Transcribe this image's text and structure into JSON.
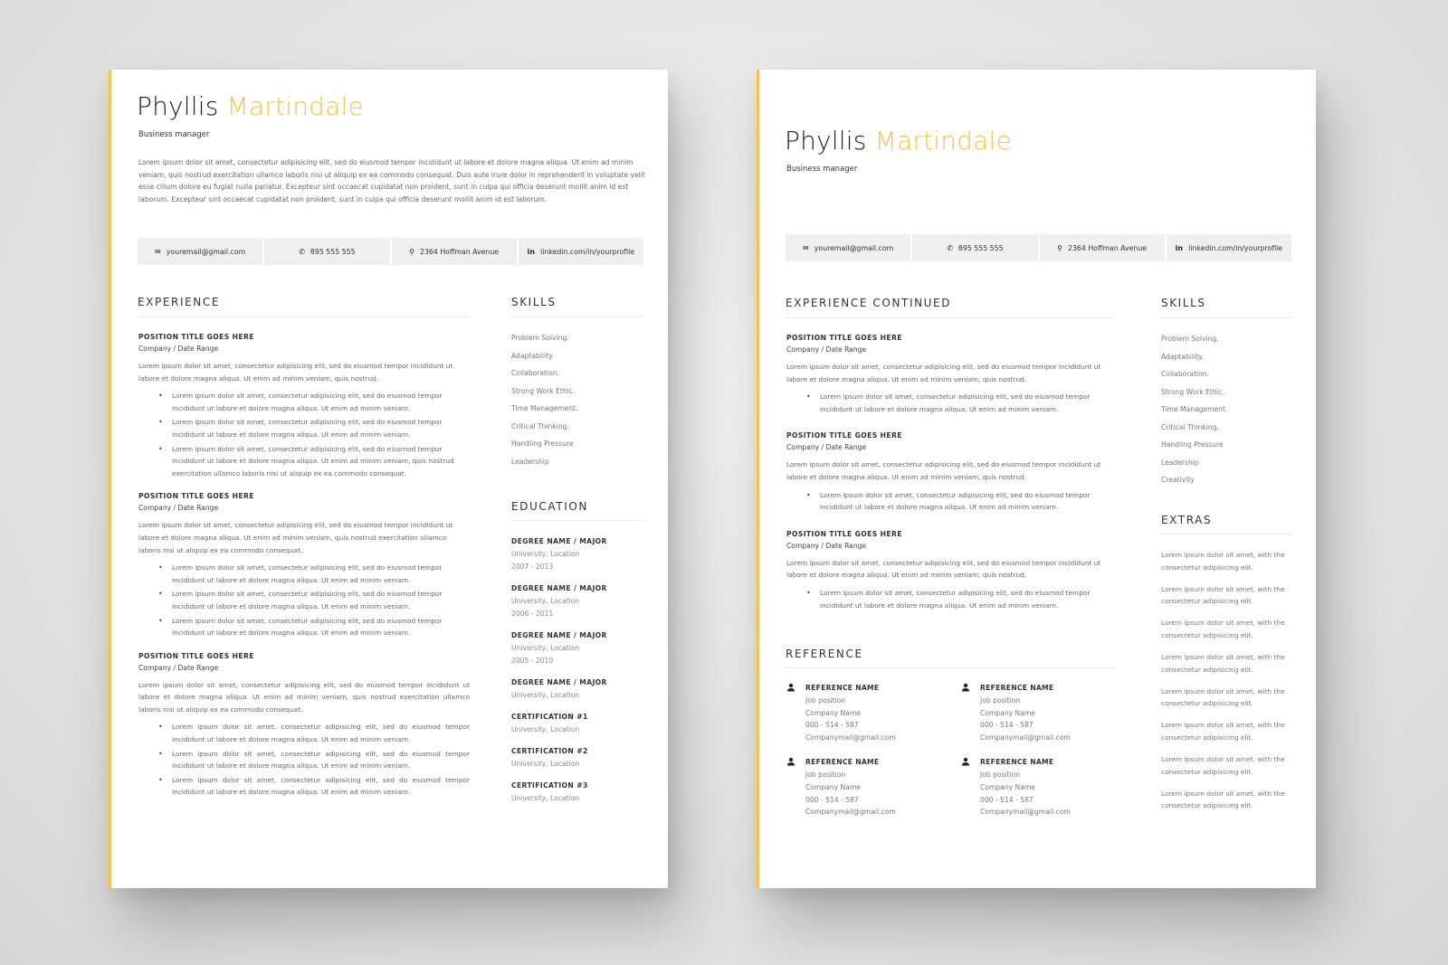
{
  "brand": {
    "accent_color": "#fbc14a",
    "text_color": "#222222",
    "bar_color": "#efefef"
  },
  "person": {
    "first_name": "Phyllis",
    "last_name": "Martindale",
    "title": "Business manager"
  },
  "summary": "Lorem ipsum dolor sit amet, consectetur adipisicing elit, sed do eiusmod tempor incididunt ut labore et dolore magna aliqua. Ut enim ad minim veniam, quis nostrud exercitation ullamco laboris nisi ut aliquip ex ea commodo consequat. Duis aute irure dolor in reprehenderit in voluptate velit esse cillum dolore eu fugiat nulla pariatur. Excepteur sint occaecat cupidatat non proident, sunt in culpa qui officia deserunt mollit anim id est laborum. Excepteur sint occaecat cupidatat non proident, sunt in culpa qui officia deserunt mollit anim id est laborum.",
  "contact": [
    {
      "icon": "envelope-icon",
      "glyph": "✉",
      "text": "youremail@gmail.com"
    },
    {
      "icon": "phone-icon",
      "glyph": "✆",
      "text": "895 555 555"
    },
    {
      "icon": "location-pin-icon",
      "glyph": "⚲",
      "text": "2364 Hoffman Avenue"
    },
    {
      "icon": "linkedin-icon",
      "glyph": "in",
      "text": "linkedin.com/in/yourprofile"
    }
  ],
  "page1": {
    "experience_title": "EXPERIENCE",
    "jobs": [
      {
        "title": "POSITION TITLE GOES HERE",
        "sub": "Company / Date Range",
        "desc": "Lorem ipsum dolor sit amet, consectetur adipisicing elit, sed do eiusmod tempor incididunt ut labore et dolore magna aliqua. Ut enim ad minim veniam, quis nostrud.",
        "bullets": [
          "Lorem ipsum dolor sit amet, consectetur adipisicing elit, sed do eiusmod tempor incididunt ut labore et dolore magna aliqua. Ut enim ad minim veniam.",
          "Lorem ipsum dolor sit amet, consectetur adipisicing elit, sed do eiusmod tempor incididunt ut labore et dolore magna aliqua. Ut enim ad minim veniam.",
          "Lorem ipsum dolor sit amet, consectetur adipisicing elit, sed do eiusmod tempor incididunt ut labore et dolore magna aliqua. Ut enim ad minim veniam, quis nostrud exercitation ullamco laboris nisi ut aliquip ex ea commodo consequat."
        ]
      },
      {
        "title": "POSITION TITLE GOES HERE",
        "sub": "Company / Date Range",
        "desc": "Lorem ipsum dolor sit amet, consectetur adipisicing elit, sed do eiusmod tempor incididunt ut labore et dolore magna aliqua. Ut enim ad minim veniam, quis nostrud exercitation ullamco laboris nisi ut aliquip ex ea commodo consequat.",
        "bullets": [
          "Lorem ipsum dolor sit amet, consectetur adipisicing elit, sed do eiusmod tempor incididunt ut labore et dolore magna aliqua. Ut enim ad minim veniam.",
          "Lorem ipsum dolor sit amet, consectetur adipisicing elit, sed do eiusmod tempor incididunt ut labore et dolore magna aliqua. Ut enim ad minim veniam.",
          "Lorem ipsum dolor sit amet, consectetur adipisicing elit, sed do eiusmod tempor incididunt ut labore et dolore magna aliqua. Ut enim ad minim veniam."
        ]
      },
      {
        "title": "POSITION TITLE GOES HERE",
        "sub": "Company / Date Range",
        "desc": "Lorem ipsum dolor sit amet, consectetur adipisicing elit, sed do eiusmod tempor incididunt ut labore et dolore magna aliqua. Ut enim ad minim veniam, quis nostrud exercitation ullamco laboris nisi ut aliquip ex ea commodo consequat.",
        "bullets": [
          "Lorem ipsum dolor sit amet, consectetur adipisicing elit, sed do eiusmod tempor incididunt ut labore et dolore magna aliqua. Ut enim ad minim veniam.",
          "Lorem ipsum dolor sit amet, consectetur adipisicing elit, sed do eiusmod tempor incididunt ut labore et dolore magna aliqua. Ut enim ad minim veniam.",
          "Lorem ipsum dolor sit amet, consectetur adipisicing elit, sed do eiusmod tempor incididunt ut labore et dolore magna aliqua. Ut enim ad minim veniam."
        ]
      }
    ],
    "skills_title": "SKILLS",
    "skills": [
      "Problem Solving.",
      "Adaptability.",
      "Collaboration.",
      "Strong Work Ethic.",
      "Time Management.",
      "Critical Thinking.",
      "Handling Pressure",
      "Leadership"
    ],
    "education_title": "EDUCATION",
    "education": [
      {
        "title": "DEGREE NAME / MAJOR",
        "lines": [
          "University, Location",
          "2007 - 2013"
        ]
      },
      {
        "title": "DEGREE NAME / MAJOR",
        "lines": [
          "University, Location",
          "2006 - 2011"
        ]
      },
      {
        "title": "DEGREE NAME / MAJOR",
        "lines": [
          "University, Location",
          "2005 - 2010"
        ]
      },
      {
        "title": "DEGREE NAME / MAJOR",
        "lines": [
          "University, Location"
        ]
      },
      {
        "title": "CERTIFICATION #1",
        "lines": [
          "University, Location"
        ]
      },
      {
        "title": "CERTIFICATION #2",
        "lines": [
          "University, Location"
        ]
      },
      {
        "title": "CERTIFICATION #3",
        "lines": [
          "University, Location"
        ]
      }
    ]
  },
  "page2": {
    "experience_title": "EXPERIENCE CONTINUED",
    "jobs": [
      {
        "title": "POSITION TITLE GOES HERE",
        "sub": "Company / Date Range",
        "desc": "Lorem ipsum dolor sit amet, consectetur adipisicing elit, sed do eiusmod tempor incididunt ut labore et dolore magna aliqua. Ut enim ad minim veniam, quis nostrud.",
        "bullets": [
          "Lorem ipsum dolor sit amet, consectetur adipisicing elit, sed do eiusmod tempor incididunt ut labore et dolore magna aliqua. Ut enim ad minim veniam."
        ]
      },
      {
        "title": "POSITION TITLE GOES HERE",
        "sub": "Company / Date Range",
        "desc": "Lorem ipsum dolor sit amet, consectetur adipisicing elit, sed do eiusmod tempor incididunt ut labore et dolore magna aliqua. Ut enim ad minim veniam, quis nostrud.",
        "bullets": [
          "Lorem ipsum dolor sit amet, consectetur adipisicing elit, sed do eiusmod tempor incididunt ut labore et dolore magna aliqua. Ut enim ad minim veniam."
        ]
      },
      {
        "title": "POSITION TITLE GOES HERE",
        "sub": "Company / Date Range",
        "desc": "Lorem ipsum dolor sit amet, consectetur adipisicing elit, sed do eiusmod tempor incididunt ut labore et dolore magna aliqua. Ut enim ad minim veniam, quis nostrud.",
        "bullets": [
          "Lorem ipsum dolor sit amet, consectetur adipisicing elit, sed do eiusmod tempor incididunt ut labore et dolore magna aliqua. Ut enim ad minim veniam."
        ]
      }
    ],
    "reference_title": "REFERENCE",
    "references": [
      {
        "name": "REFERENCE NAME",
        "position": "Job position",
        "company": "Company Name",
        "phone": "000 - 514 - 587",
        "email": "Companymail@gmail.com"
      },
      {
        "name": "REFERENCE NAME",
        "position": "Job position",
        "company": "Company Name",
        "phone": "000 - 514 - 587",
        "email": "Companymail@gmail.com"
      },
      {
        "name": "REFERENCE NAME",
        "position": "Job position",
        "company": "Company Name",
        "phone": "000 - 514 - 587",
        "email": "Companymail@gmail.com"
      },
      {
        "name": "REFERENCE NAME",
        "position": "Job position",
        "company": "Company Name",
        "phone": "000 - 514 - 587",
        "email": "Companymail@gmail.com"
      }
    ],
    "skills_title": "SKILLS",
    "skills": [
      "Problem Solving.",
      "Adaptability.",
      "Collaboration.",
      "Strong Work Ethic.",
      "Time Management.",
      "Critical Thinking.",
      "Handling Pressure",
      "Leadership",
      "Creativity"
    ],
    "extras_title": "EXTRAS",
    "extras": [
      "Lorem ipsum dolor sit amet, with the consectetur adipisicing elit.",
      "Lorem ipsum dolor sit amet, with the consectetur adipisicing elit.",
      "Lorem ipsum dolor sit amet, with the consectetur adipisicing elit.",
      "Lorem ipsum dolor sit amet, with the consectetur adipisicing elit.",
      "Lorem ipsum dolor sit amet, with the consectetur adipisicing elit.",
      "Lorem ipsum dolor sit amet, with the consectetur adipisicing elit.",
      "Lorem ipsum dolor sit amet, with the consectetur adipisicing elit.",
      "Lorem ipsum dolor sit amet, with the consectetur adipisicing elit."
    ]
  }
}
